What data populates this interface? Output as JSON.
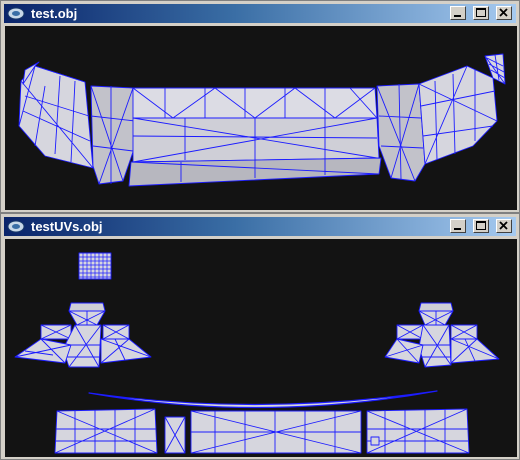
{
  "windows": [
    {
      "title": "test.obj",
      "icon": "app-icon",
      "view": "3d-model-wireframe"
    },
    {
      "title": "testUVs.obj",
      "icon": "app-icon",
      "view": "uv-layout-wireframe"
    }
  ],
  "title_buttons": [
    "minimize-icon",
    "maximize-icon",
    "close-icon"
  ],
  "colors": {
    "viewport_bg": "#131313",
    "mesh_fill": "#d8d8e0",
    "wire": "#1c1cff",
    "title_start": "#0a246a",
    "title_end": "#a6caf0",
    "chrome": "#d4d0c8"
  }
}
